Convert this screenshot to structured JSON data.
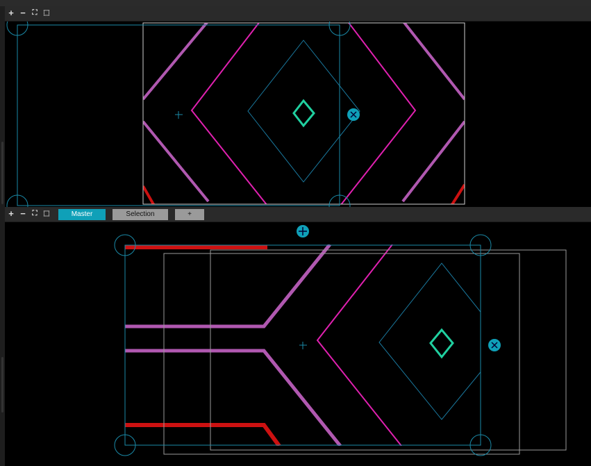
{
  "toolbar_top": {
    "zoom_in": "+",
    "zoom_out": "−",
    "fit": "⛶",
    "select": "⬚"
  },
  "toolbar_bottom": {
    "zoom_in": "+",
    "zoom_out": "−",
    "fit": "⛶",
    "select": "⬚",
    "tabs": [
      {
        "label": "Master",
        "active": true
      },
      {
        "label": "Selection",
        "active": false
      },
      {
        "label": "+",
        "active": false
      }
    ]
  },
  "colors": {
    "accent": "#0fa0b8",
    "magenta": "#e020b0",
    "violet": "#b058b0",
    "red": "#cc1111",
    "green_diamond": "#20d0a0",
    "guide": "#1a8aa8"
  },
  "icons": [
    "zoom-in-icon",
    "zoom-out-icon",
    "fit-view-icon",
    "marquee-select-icon",
    "move-handle-icon",
    "rotate-handle-icon",
    "crosshair-icon"
  ]
}
